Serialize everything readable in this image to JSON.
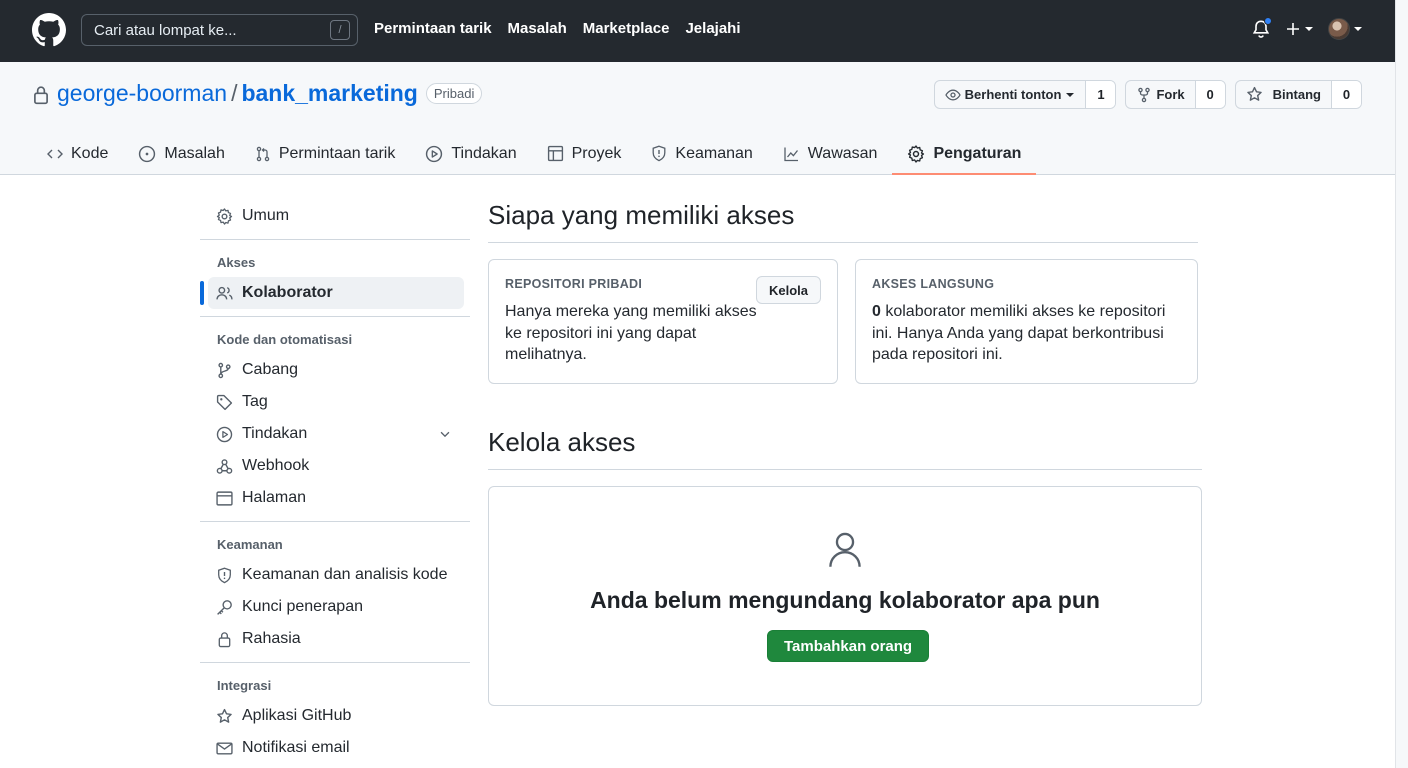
{
  "header": {
    "search_placeholder": "Cari atau lompat ke...",
    "slash_key": "/",
    "nav": [
      "Permintaan tarik",
      "Masalah",
      "Marketplace",
      "Jelajahi"
    ]
  },
  "repo": {
    "owner": "george-boorman",
    "separator": "/",
    "name": "bank_marketing",
    "visibility": "Pribadi",
    "watch_label": "Berhenti tonton",
    "watch_count": "1",
    "fork_label": "Fork",
    "fork_count": "0",
    "star_label": "Bintang",
    "star_count": "0"
  },
  "tabs": [
    {
      "label": "Kode"
    },
    {
      "label": "Masalah"
    },
    {
      "label": "Permintaan tarik"
    },
    {
      "label": "Tindakan"
    },
    {
      "label": "Proyek"
    },
    {
      "label": "Keamanan"
    },
    {
      "label": "Wawasan"
    },
    {
      "label": "Pengaturan"
    }
  ],
  "sidebar": {
    "general": "Umum",
    "access_heading": "Akses",
    "collaborators": "Kolaborator",
    "code_heading": "Kode dan otomatisasi",
    "branches": "Cabang",
    "tags": "Tag",
    "actions": "Tindakan",
    "webhooks": "Webhook",
    "pages": "Halaman",
    "security_heading": "Keamanan",
    "code_security": "Keamanan dan analisis kode",
    "deploy_keys": "Kunci penerapan",
    "secrets": "Rahasia",
    "integrations_heading": "Integrasi",
    "github_apps": "Aplikasi GitHub",
    "email_notifications": "Notifikasi email"
  },
  "main": {
    "who_title": "Siapa yang memiliki akses",
    "private_label": "Repositori pribadi",
    "private_text": "Hanya mereka yang memiliki akses ke repositori ini yang dapat melihatnya.",
    "manage_button": "Kelola",
    "direct_label": "Akses langsung",
    "direct_count": "0",
    "direct_text": " kolaborator memiliki akses ke repositori ini. Hanya Anda yang dapat berkontribusi pada repositori ini.",
    "manage_title": "Kelola akses",
    "empty_title": "Anda belum mengundang kolaborator apa pun",
    "add_button": "Tambahkan orang"
  },
  "colors": {
    "header_bg": "#24292f",
    "link": "#0969da",
    "active_tab_underline": "#fd8c73",
    "primary_button": "#1f883d"
  }
}
